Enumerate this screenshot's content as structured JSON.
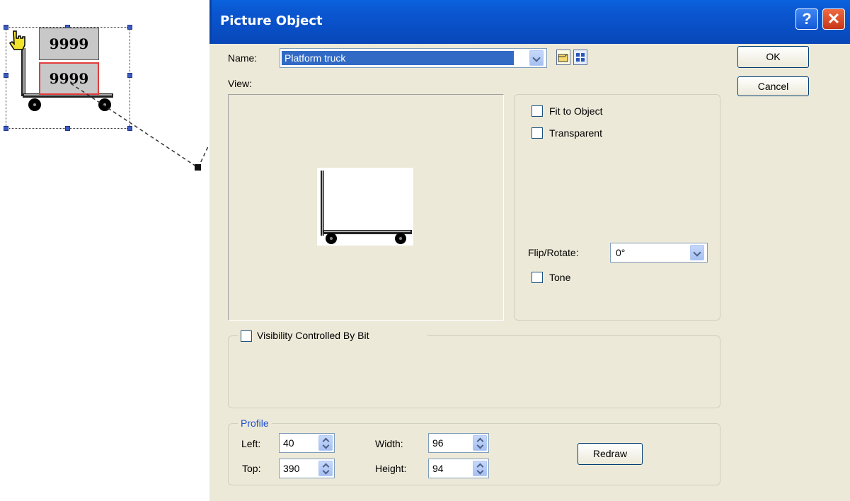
{
  "canvas": {
    "object_top_value": "9999",
    "object_bottom_value": "9999"
  },
  "dialog": {
    "title": "Picture Object",
    "help_glyph": "?",
    "close_glyph": "✕",
    "name_label": "Name:",
    "name_value": "Platform truck",
    "view_label": "View:",
    "ok_label": "OK",
    "cancel_label": "Cancel",
    "fit_to_object_label": "Fit to Object",
    "fit_to_object_checked": false,
    "transparent_label": "Transparent",
    "transparent_checked": false,
    "flip_rotate_label": "Flip/Rotate:",
    "flip_rotate_value": "0°",
    "tone_label": "Tone",
    "tone_checked": false,
    "visibility_label": "Visibility Controlled By Bit",
    "visibility_checked": false,
    "profile": {
      "title": "Profile",
      "left_label": "Left:",
      "left_value": "40",
      "top_label": "Top:",
      "top_value": "390",
      "width_label": "Width:",
      "width_value": "96",
      "height_label": "Height:",
      "height_value": "94",
      "redraw_label": "Redraw"
    }
  },
  "colors": {
    "titlebar": "#0a56d0",
    "dialog_bg": "#ece9d8",
    "profile_title": "#1e4fd2",
    "selection_handle": "#3b5bc2",
    "selected_object_border": "#e43b3b"
  },
  "icons": [
    "hand-pointer-icon",
    "dropdown-arrow-icon",
    "open-folder-icon",
    "grid-view-icon",
    "help-icon",
    "close-icon",
    "spin-arrows-icon"
  ]
}
